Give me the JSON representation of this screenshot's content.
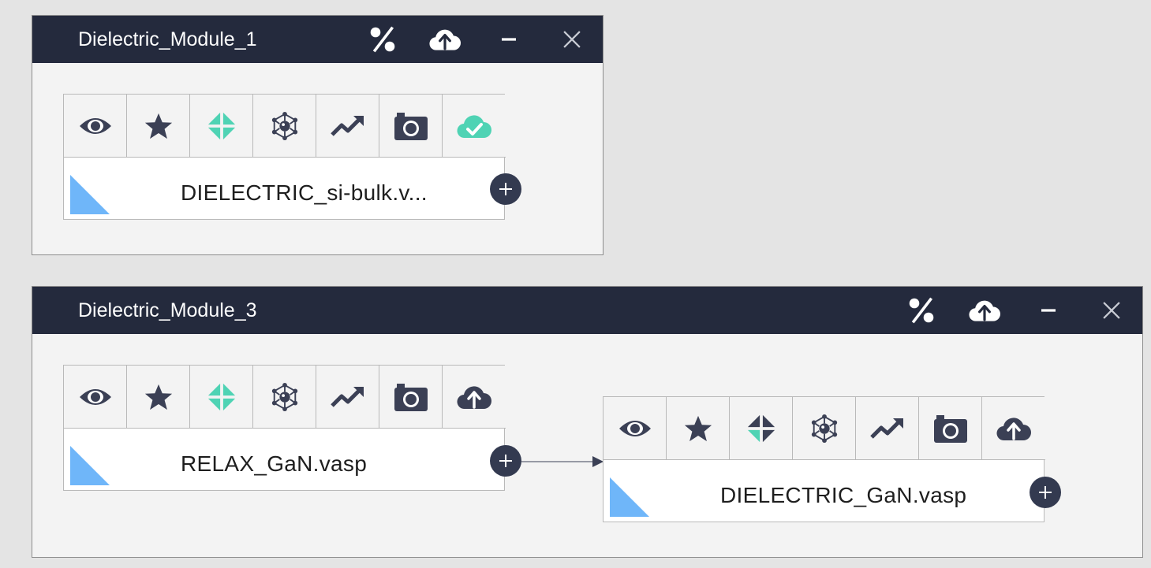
{
  "modules": [
    {
      "title": "Dielectric_Module_1",
      "header_icons": [
        "percent-icon",
        "cloud-upload-icon",
        "minimize-icon",
        "close-icon"
      ],
      "nodes": [
        {
          "file_name": "DIELECTRIC_si-bulk.v...",
          "tools": [
            "eye-icon",
            "star-icon",
            "diamond-icon",
            "molecule-icon",
            "trending-up-icon",
            "camera-icon",
            "cloud-check-icon"
          ],
          "status": "complete"
        }
      ]
    },
    {
      "title": "Dielectric_Module_3",
      "header_icons": [
        "percent-icon",
        "cloud-upload-icon",
        "minimize-icon",
        "close-icon"
      ],
      "nodes": [
        {
          "file_name": "RELAX_GaN.vasp",
          "tools": [
            "eye-icon",
            "star-icon",
            "diamond-icon",
            "molecule-icon",
            "trending-up-icon",
            "camera-icon",
            "cloud-upload-icon"
          ],
          "status": "pending"
        },
        {
          "file_name": "DIELECTRIC_GaN.vasp",
          "tools": [
            "eye-icon",
            "star-icon",
            "diamond-icon",
            "molecule-icon",
            "trending-up-icon",
            "camera-icon",
            "cloud-upload-icon"
          ],
          "status": "pending"
        }
      ]
    }
  ],
  "colors": {
    "header_bg": "#242a3d",
    "icon_dark": "#3b4055",
    "accent_teal": "#4fd3b4",
    "file_triangle": "#6fb6f9",
    "panel_bg": "#f3f3f3",
    "page_bg": "#e4e4e4"
  }
}
